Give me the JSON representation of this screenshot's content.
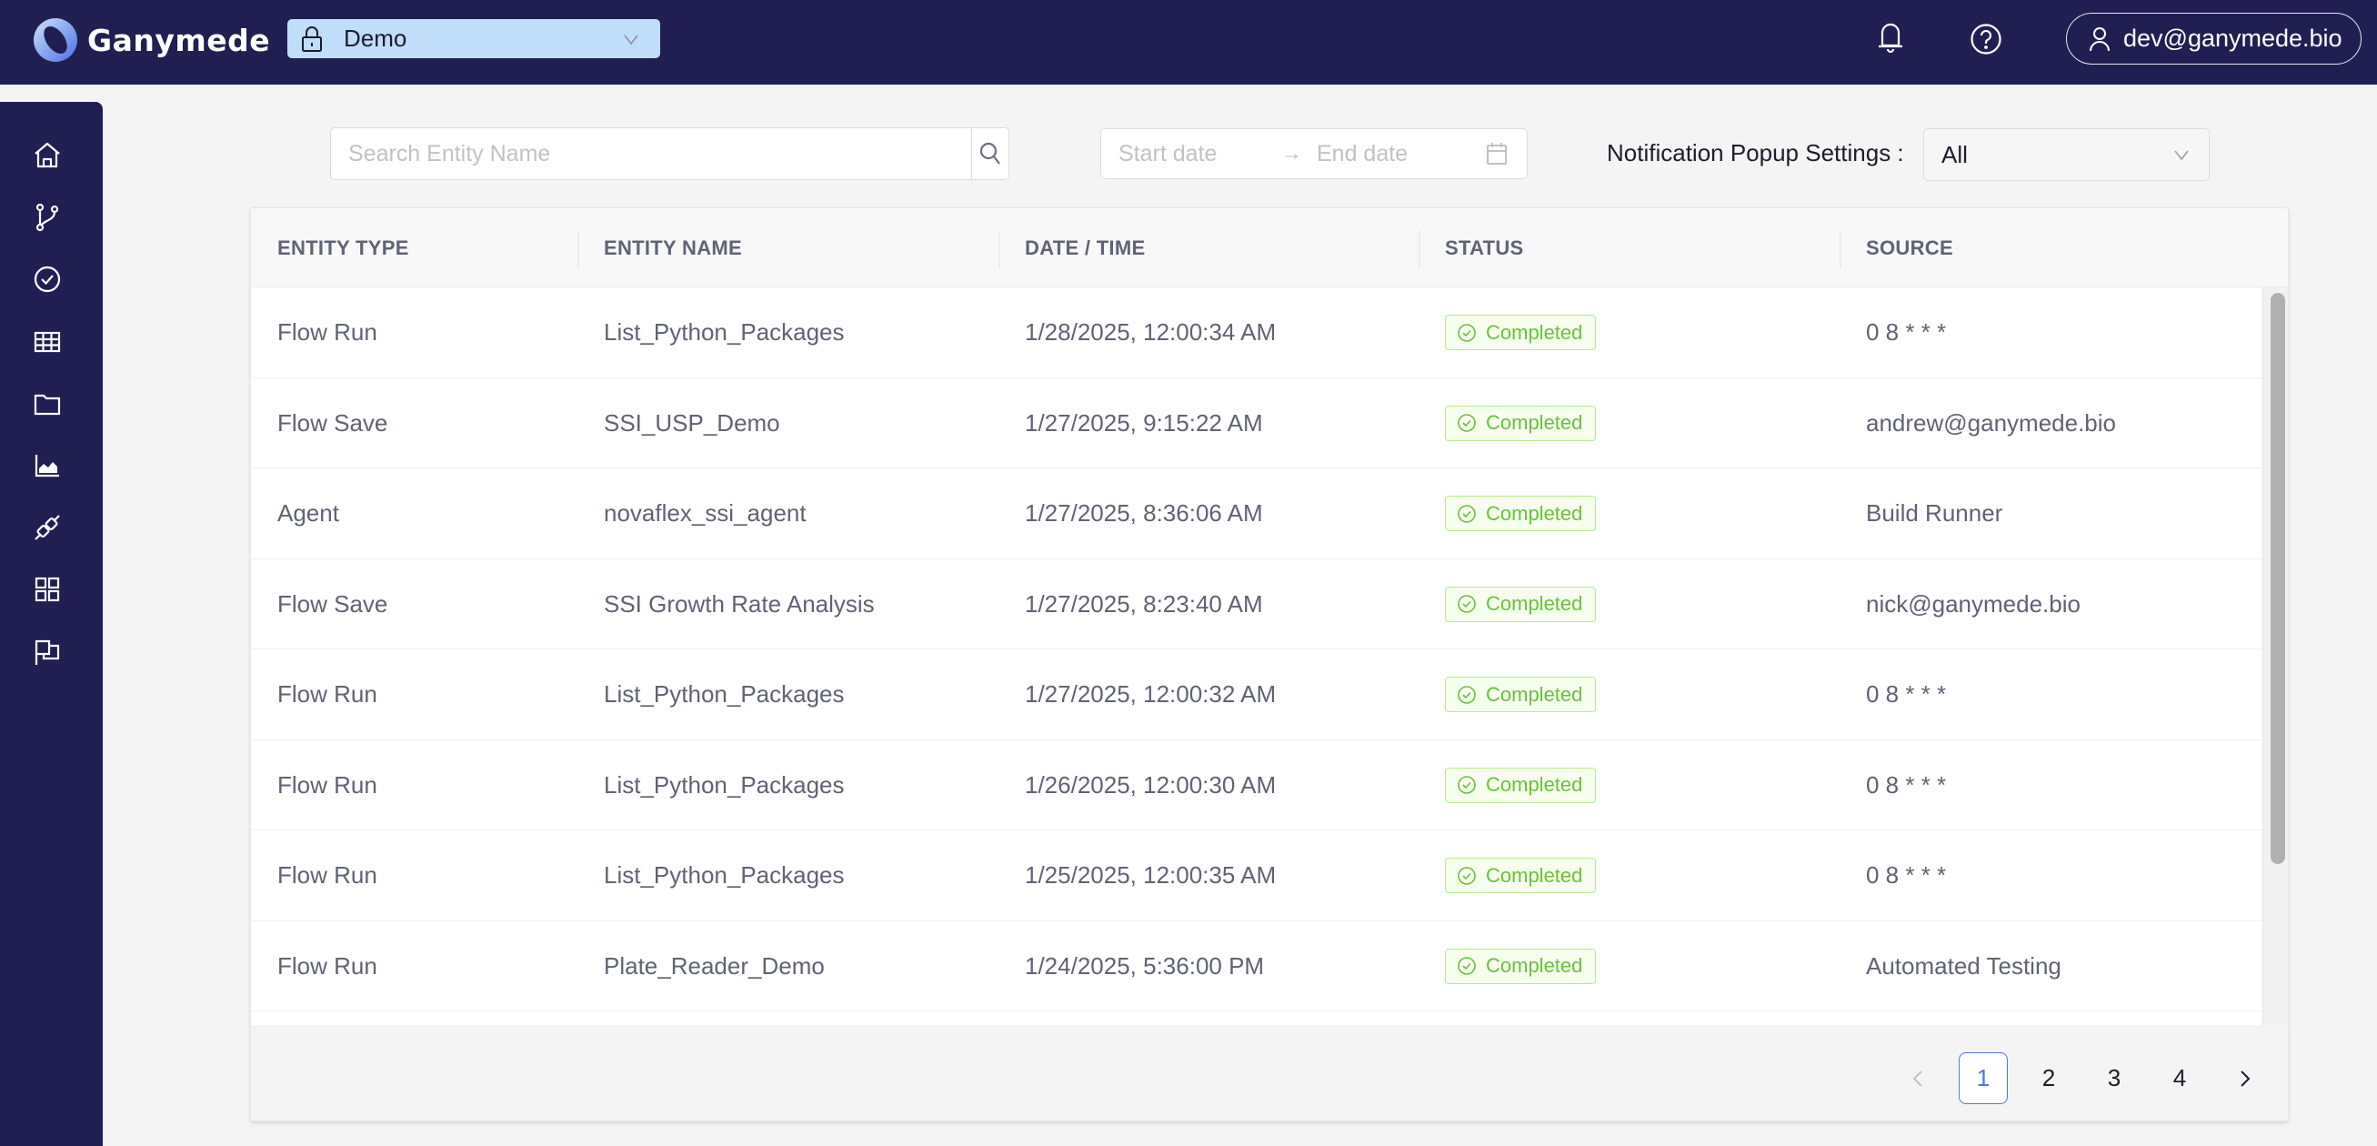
{
  "header": {
    "brand": "Ganymede",
    "workspace": "Demo",
    "user": "dev@ganymede.bio"
  },
  "sidebar": {
    "items": [
      {
        "name": "home",
        "icon": "home-icon"
      },
      {
        "name": "flows",
        "icon": "branch-icon"
      },
      {
        "name": "runs",
        "icon": "check-circle-icon"
      },
      {
        "name": "tables",
        "icon": "table-icon"
      },
      {
        "name": "files",
        "icon": "folder-icon"
      },
      {
        "name": "dashboards",
        "icon": "area-chart-icon"
      },
      {
        "name": "connections",
        "icon": "plug-icon"
      },
      {
        "name": "apps",
        "icon": "grid-icon"
      },
      {
        "name": "notifications",
        "icon": "flag-icon"
      }
    ]
  },
  "toolbar": {
    "search_placeholder": "Search Entity Name",
    "search_value": "",
    "start_date_placeholder": "Start date",
    "end_date_placeholder": "End date",
    "date_arrow": "→",
    "notification_label": "Notification Popup Settings :",
    "notification_value": "All"
  },
  "table": {
    "columns": [
      "ENTITY TYPE",
      "ENTITY NAME",
      "DATE / TIME",
      "STATUS",
      "SOURCE"
    ],
    "rows": [
      {
        "type": "Flow Run",
        "name": "List_Python_Packages",
        "datetime": "1/28/2025, 12:00:34 AM",
        "status": "Completed",
        "source": "0 8 * * *"
      },
      {
        "type": "Flow Save",
        "name": "SSI_USP_Demo",
        "datetime": "1/27/2025, 9:15:22 AM",
        "status": "Completed",
        "source": "andrew@ganymede.bio"
      },
      {
        "type": "Agent",
        "name": "novaflex_ssi_agent",
        "datetime": "1/27/2025, 8:36:06 AM",
        "status": "Completed",
        "source": "Build Runner"
      },
      {
        "type": "Flow Save",
        "name": "SSI Growth Rate Analysis",
        "datetime": "1/27/2025, 8:23:40 AM",
        "status": "Completed",
        "source": "nick@ganymede.bio"
      },
      {
        "type": "Flow Run",
        "name": "List_Python_Packages",
        "datetime": "1/27/2025, 12:00:32 AM",
        "status": "Completed",
        "source": "0 8 * * *"
      },
      {
        "type": "Flow Run",
        "name": "List_Python_Packages",
        "datetime": "1/26/2025, 12:00:30 AM",
        "status": "Completed",
        "source": "0 8 * * *"
      },
      {
        "type": "Flow Run",
        "name": "List_Python_Packages",
        "datetime": "1/25/2025, 12:00:35 AM",
        "status": "Completed",
        "source": "0 8 * * *"
      },
      {
        "type": "Flow Run",
        "name": "Plate_Reader_Demo",
        "datetime": "1/24/2025, 5:36:00 PM",
        "status": "Completed",
        "source": "Automated Testing"
      }
    ]
  },
  "pagination": {
    "pages": [
      "1",
      "2",
      "3",
      "4"
    ],
    "current": "1"
  },
  "colors": {
    "nav_bg": "#211f52",
    "workspace_bg": "#c0ddf9",
    "status_completed": "#67c23a",
    "accent": "#4a78e8"
  }
}
